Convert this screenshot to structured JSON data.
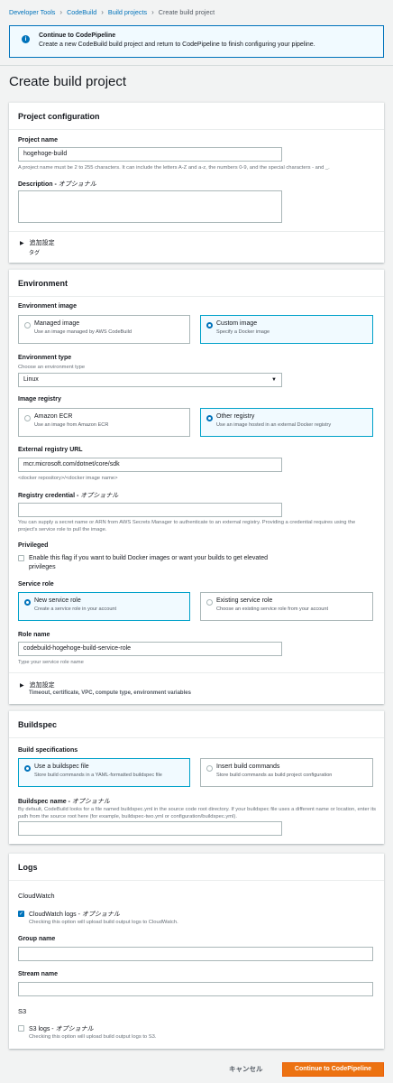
{
  "breadcrumbs": [
    {
      "label": "Developer Tools"
    },
    {
      "label": "CodeBuild"
    },
    {
      "label": "Build projects"
    },
    {
      "label": "Create build project"
    }
  ],
  "flash": {
    "title": "Continue to CodePipeline",
    "message": "Create a new CodeBuild build project and return to CodePipeline to finish configuring your pipeline.",
    "icon": "info-icon"
  },
  "page_title": "Create build project",
  "project": {
    "header": "Project configuration",
    "name_label": "Project name",
    "name_value": "hogehoge-build",
    "name_hint": "A project name must be 2 to 255 characters. It can include the letters A-Z and a-z, the numbers 0-9, and the special characters - and _.",
    "desc_label": "Description - ",
    "desc_optional": "オプショナル",
    "desc_value": "",
    "additional_label": "追加設定",
    "additional_sub": "タグ"
  },
  "environment": {
    "header": "Environment",
    "image_label": "Environment image",
    "image_options": [
      {
        "title": "Managed image",
        "desc": "Use an image managed by AWS CodeBuild",
        "selected": false
      },
      {
        "title": "Custom image",
        "desc": "Specify a Docker image",
        "selected": true
      }
    ],
    "type_label": "Environment type",
    "type_hint": "Choose an environment type",
    "type_value": "Linux",
    "registry_label": "Image registry",
    "registry_options": [
      {
        "title": "Amazon ECR",
        "desc": "Use an image from Amazon ECR",
        "selected": false
      },
      {
        "title": "Other registry",
        "desc": "Use an image hosted in an external Docker registry",
        "selected": true
      }
    ],
    "ext_url_label": "External registry URL",
    "ext_url_value": "mcr.microsoft.com/dotnet/core/sdk",
    "ext_url_hint": "<docker repository>/<docker image name>",
    "cred_label": "Registry credential - ",
    "cred_optional": "オプショナル",
    "cred_value": "",
    "cred_hint": "You can supply a secret name or ARN from AWS Secrets Manager to authenticate to an external registry. Providing a credential requires using the project's service role to pull the image.",
    "privileged_label": "Privileged",
    "privileged_text": "Enable this flag if you want to build Docker images or want your builds to get elevated privileges",
    "role_label": "Service role",
    "role_options": [
      {
        "title": "New service role",
        "desc": "Create a service role in your account",
        "selected": true
      },
      {
        "title": "Existing service role",
        "desc": "Choose an existing service role from your account",
        "selected": false
      }
    ],
    "role_name_label": "Role name",
    "role_name_value": "codebuild-hogehoge-build-service-role",
    "role_name_hint": "Type your service role name",
    "additional_label": "追加設定",
    "additional_sub": "Timeout, certificate, VPC, compute type, environment variables"
  },
  "buildspec": {
    "header": "Buildspec",
    "spec_label": "Build specifications",
    "options": [
      {
        "title": "Use a buildspec file",
        "desc": "Store build commands in a YAML-formatted buildspec file",
        "selected": true
      },
      {
        "title": "Insert build commands",
        "desc": "Store build commands as build project configuration",
        "selected": false
      }
    ],
    "name_label": "Buildspec name - ",
    "name_optional": "オプショナル",
    "name_hint": "By default, CodeBuild looks for a file named buildspec.yml in the source code root directory. If your buildspec file uses a different name or location, enter its path from the source root here (for example, buildspec-two.yml or configuration/buildspec.yml).",
    "name_value": ""
  },
  "logs": {
    "header": "Logs",
    "cw_label": "CloudWatch",
    "cw_check_label": "CloudWatch logs - ",
    "cw_check_optional": "オプショナル",
    "cw_check_desc": "Checking this option will upload build output logs to CloudWatch.",
    "cw_checked": true,
    "group_label": "Group name",
    "group_value": "",
    "stream_label": "Stream name",
    "stream_value": "",
    "s3_label": "S3",
    "s3_check_label": "S3 logs - ",
    "s3_check_optional": "オプショナル",
    "s3_check_desc": "Checking this option will upload build output logs to S3.",
    "s3_checked": false
  },
  "footer": {
    "cancel_label": "キャンセル",
    "submit_label": "Continue to CodePipeline"
  },
  "colors": {
    "primary": "#ec7211",
    "link": "#0073bb",
    "selected_border": "#00a1c9"
  }
}
